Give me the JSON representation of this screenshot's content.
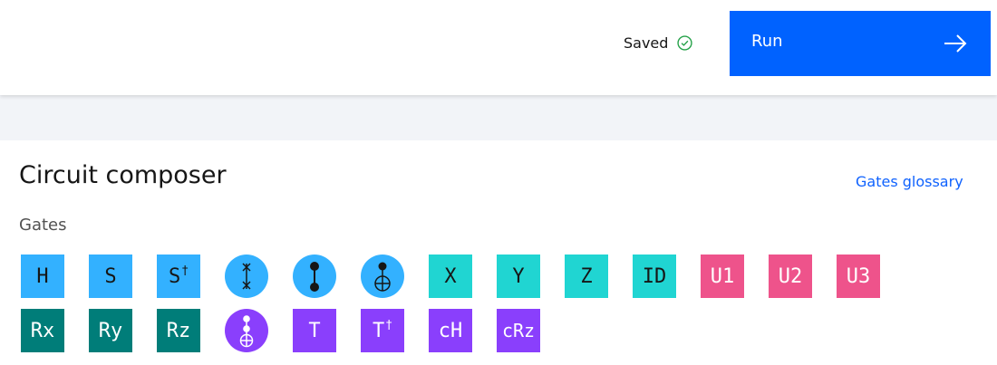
{
  "header": {
    "saved_label": "Saved",
    "run_label": "Run"
  },
  "composer": {
    "title": "Circuit composer",
    "glossary_link": "Gates glossary",
    "gates_heading": "Gates"
  },
  "colors": {
    "run_button": "#0062ff",
    "blue_gate": "#33b1ff",
    "teal_gate": "#20d5d2",
    "pink_gate": "#ee538b",
    "dark_teal_gate": "#007d79",
    "purple_gate": "#8a3ffc",
    "saved_check": "#24a148"
  },
  "gates": {
    "row1": [
      {
        "label": "H",
        "color": "blue"
      },
      {
        "label": "S",
        "color": "blue"
      },
      {
        "label": "S",
        "superscript": "†",
        "color": "blue"
      },
      {
        "icon": "swap-icon",
        "color": "blue"
      },
      {
        "icon": "controlled-z-icon",
        "color": "blue"
      },
      {
        "icon": "cnot-icon",
        "color": "blue"
      },
      {
        "label": "X",
        "color": "teal"
      },
      {
        "label": "Y",
        "color": "teal"
      },
      {
        "label": "Z",
        "color": "teal"
      },
      {
        "label": "ID",
        "color": "teal"
      },
      {
        "label": "U1",
        "color": "pink"
      },
      {
        "label": "U2",
        "color": "pink"
      },
      {
        "label": "U3",
        "color": "pink"
      }
    ],
    "row2": [
      {
        "label": "Rx",
        "color": "dark-teal"
      },
      {
        "label": "Ry",
        "color": "dark-teal"
      },
      {
        "label": "Rz",
        "color": "dark-teal"
      },
      {
        "icon": "toffoli-icon",
        "color": "purple"
      },
      {
        "label": "T",
        "color": "purple"
      },
      {
        "label": "T",
        "superscript": "†",
        "color": "purple"
      },
      {
        "label": "cH",
        "color": "purple"
      },
      {
        "label": "cRz",
        "color": "purple"
      }
    ]
  }
}
